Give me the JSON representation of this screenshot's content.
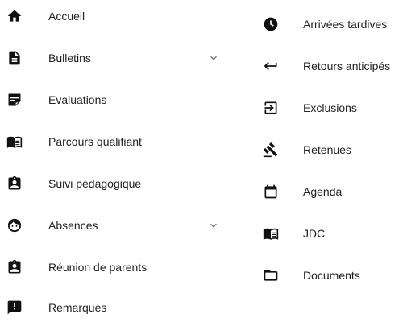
{
  "left_menu": [
    {
      "label": "Accueil",
      "icon": "home-icon"
    },
    {
      "label": "Bulletins",
      "icon": "document-icon",
      "expandable": true
    },
    {
      "label": "Evaluations",
      "icon": "note-icon"
    },
    {
      "label": "Parcours qualifiant",
      "icon": "book-icon"
    },
    {
      "label": "Suivi pédagogique",
      "icon": "clipboard-person-icon"
    },
    {
      "label": "Absences",
      "icon": "face-icon",
      "expandable": true
    },
    {
      "label": "Réunion de parents",
      "icon": "clipboard-person-icon"
    },
    {
      "label": "Remarques",
      "icon": "alert-icon"
    }
  ],
  "right_menu": [
    {
      "label": "Arrivées tardives",
      "icon": "clock-icon"
    },
    {
      "label": "Retours anticipés",
      "icon": "return-arrow-icon"
    },
    {
      "label": "Exclusions",
      "icon": "exit-box-icon"
    },
    {
      "label": "Retenues",
      "icon": "gavel-icon"
    },
    {
      "label": "Agenda",
      "icon": "calendar-icon"
    },
    {
      "label": "JDC",
      "icon": "book-icon"
    },
    {
      "label": "Documents",
      "icon": "folder-icon"
    }
  ],
  "colors": {
    "text": "#222222",
    "icon": "#111111",
    "chevron": "#777777"
  }
}
